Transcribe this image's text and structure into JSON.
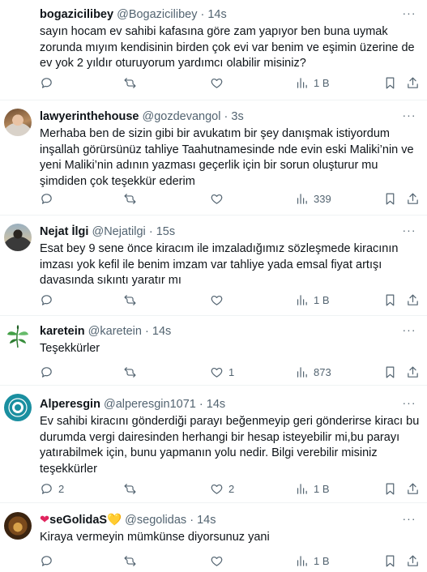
{
  "tweets": [
    {
      "name": "bogazicilibey",
      "handle": "@Bogazicilibey",
      "time": "14s",
      "text": "sayın hocam ev sahibi kafasına göre zam yapıyor ben buna uymak zorunda mıyım kendisinin birden çok evi var benim ve eşimin üzerine de ev yok 2 yıldır oturuyorum yardımcı olabilir misiniz?",
      "replies": "",
      "retweets": "",
      "likes": "",
      "views": "1 B",
      "avatar": "blank"
    },
    {
      "name": "lawyerinthehouse",
      "handle": "@gozdevangol",
      "time": "3s",
      "text": "Merhaba ben de sizin gibi bir avukatım bir şey danışmak istiyordum inşallah görürsünüz tahliye Taahutnamesinde nde evin eski Maliki’nin ve yeni Maliki’nin adının yazması geçerlik için bir sorun oluşturur mu şimdiden çok teşekkür ederim",
      "replies": "",
      "retweets": "",
      "likes": "",
      "views": "339",
      "avatar": "photo-woman"
    },
    {
      "name": "Nejat İlgi",
      "handle": "@Nejatilgi",
      "time": "15s",
      "text": "Esat bey 9 sene önce kiracım ile imzaladığımız sözleşmede kiracının imzası yok kefil ile benim imzam var tahliye yada emsal fiyat artışı davasında sıkıntı yaratır mı",
      "replies": "",
      "retweets": "",
      "likes": "",
      "views": "1 B",
      "avatar": "photo-man"
    },
    {
      "name": "karetein",
      "handle": "@karetein",
      "time": "14s",
      "text": "Teşekkürler",
      "replies": "",
      "retweets": "",
      "likes": "1",
      "views": "873",
      "avatar": "leaf"
    },
    {
      "name": "Alperesgin",
      "handle": "@alperesgin1071",
      "time": "14s",
      "text": "Ev sahibi kiracını gönderdiği parayı beğenmeyip geri gönderirse kiracı bu durumda vergi dairesinden herhangi bir hesap isteyebilir mi,bu parayı yatırabilmek için, bunu yapmanın yolu nedir. Bilgi verebilir misiniz teşekkürler",
      "replies": "2",
      "retweets": "",
      "likes": "2",
      "views": "1 B",
      "avatar": "seal"
    },
    {
      "name_prefix": "❤",
      "name": "seGolidaS",
      "name_suffix": "💛",
      "handle": "@segolidas",
      "time": "14s",
      "text": "Kiraya vermeyin mümkünse diyorsunuz yani",
      "replies": "",
      "retweets": "",
      "likes": "",
      "views": "1 B",
      "avatar": "lion"
    }
  ],
  "ui": {
    "dot": "·",
    "more": "···"
  },
  "colors": {
    "text": "#0f1419",
    "secondary": "#536471",
    "divider": "#eff3f4",
    "accent": "#1d9bf0"
  },
  "icons": {
    "reply": "reply-icon",
    "retweet": "retweet-icon",
    "like": "like-icon",
    "views": "views-icon",
    "bookmark": "bookmark-icon",
    "share": "share-icon"
  }
}
